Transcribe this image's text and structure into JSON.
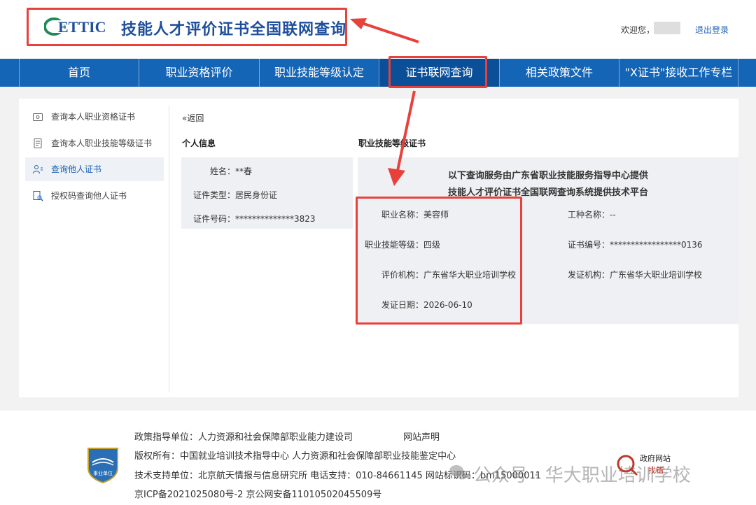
{
  "header": {
    "logo_text": "ETTIC",
    "site_title": "技能人才评价证书全国联网查询",
    "welcome": "欢迎您，",
    "logout": "退出登录"
  },
  "nav": {
    "items": [
      {
        "label": "首页"
      },
      {
        "label": "职业资格评价"
      },
      {
        "label": "职业技能等级认定"
      },
      {
        "label": "证书联网查询"
      },
      {
        "label": "相关政策文件"
      },
      {
        "label": "\"X证书\"接收工作专栏"
      }
    ]
  },
  "sidebar": {
    "items": [
      {
        "label": "查询本人职业资格证书"
      },
      {
        "label": "查询本人职业技能等级证书"
      },
      {
        "label": "查询他人证书"
      },
      {
        "label": "授权码查询他人证书"
      }
    ]
  },
  "main": {
    "back": "«返回",
    "personal": {
      "title": "个人信息",
      "name": "姓名：**春",
      "id_type": "证件类型：居民身份证",
      "id_number": "证件号码：**************3823"
    },
    "certificate": {
      "title": "职业技能等级证书",
      "notice_line1": "以下查询服务由广东省职业技能服务指导中心提供",
      "notice_line2": "技能人才评价证书全国联网查询系统提供技术平台",
      "occupation": "职业名称：美容师",
      "work_type": "工种名称：--",
      "level": "职业技能等级：四级",
      "cert_number": "证书编号：*****************0136",
      "evaluator": "评价机构：广东省华大职业培训学校",
      "issuer": "发证机构：广东省华大职业培训学校",
      "issue_date": "发证日期：2026-06-10"
    }
  },
  "footer": {
    "line1": "政策指导单位：人力资源和社会保障部职业能力建设司",
    "statement": "网站声明",
    "line2": "版权所有：中国就业培训技术指导中心   人力资源和社会保障部职业技能鉴定中心",
    "line3": "技术支持单位：北京航天情报与信息研究所   电话支持：010-84661145   网站标识码：bm15000011",
    "line4": "京ICP备2021025080号-2    京公网安备11010502045509号",
    "emblem_text": "事业单位",
    "gov_logo_line1": "政府网站",
    "gov_logo_line2": "找错",
    "watermark": "公众号 · 华大职业培训学校"
  },
  "colors": {
    "nav_blue": "#1565b7",
    "highlight_red": "#e8413c",
    "brand_blue": "#1f4f9c"
  }
}
